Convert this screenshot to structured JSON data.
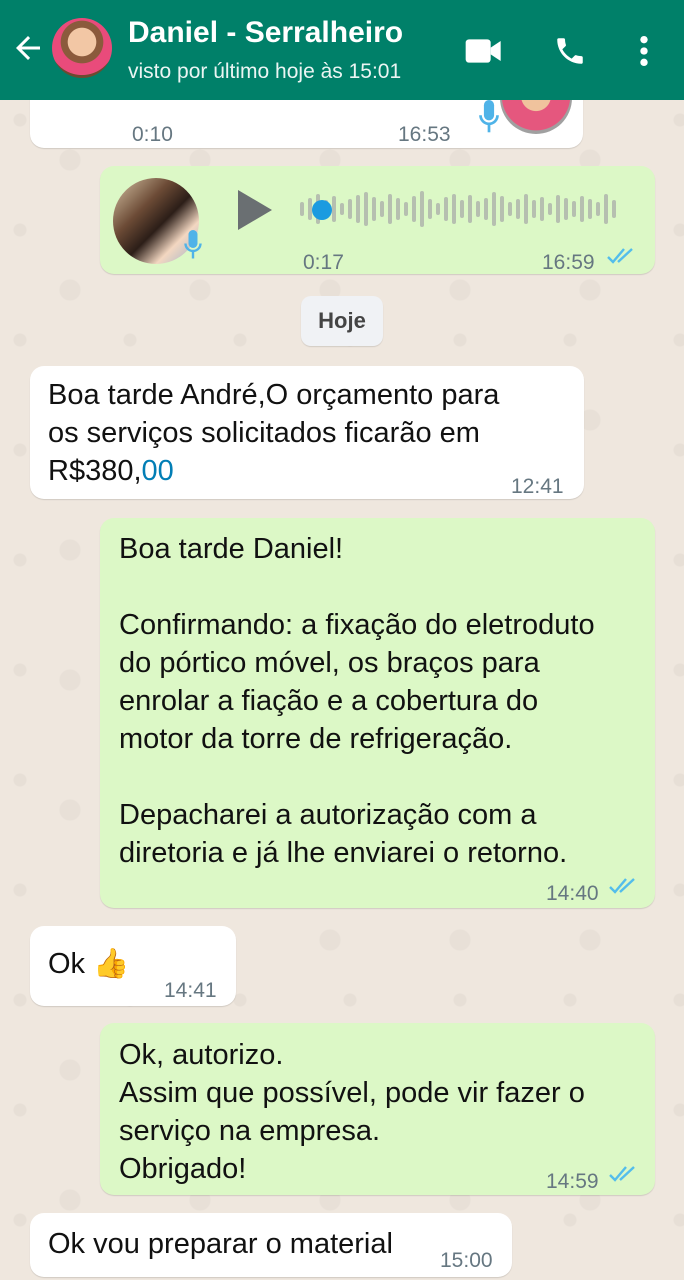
{
  "header": {
    "contact_name": "Daniel - Serralheiro",
    "last_seen": "visto por último hoje às 15:01",
    "bg_color": "#008069"
  },
  "messages": {
    "audio_in": {
      "duration": "0:10",
      "time": "16:53"
    },
    "audio_out": {
      "duration": "0:17",
      "time": "16:59",
      "progress": 0.0
    },
    "date_divider": "Hoje",
    "m1": {
      "text_before": "Boa tarde André,O orçamento para\nos serviços solicitados ficarão em\nR$380,",
      "text_link": "00",
      "time": "12:41"
    },
    "m2": {
      "text": "Boa tarde Daniel!\n\nConfirmando: a fixação do eletroduto\ndo pórtico móvel, os braços para\nenrolar a fiação e a cobertura do\nmotor da torre de refrigeração.\n\nDepacharei a autorização com a\ndiretoria e já lhe enviarei o retorno.",
      "time": "14:40"
    },
    "m3": {
      "text": "Ok 👍",
      "time": "14:41"
    },
    "m4": {
      "text": "Ok, autorizo.\nAssim que possível, pode vir fazer o\nserviço na empresa.\nObrigado!",
      "time": "14:59"
    },
    "m5": {
      "text": "Ok vou preparar o material",
      "time": "15:00"
    }
  },
  "colors": {
    "incoming": "#ffffff",
    "outgoing": "#dcf8c6",
    "read_ticks": "#53bdeb"
  }
}
